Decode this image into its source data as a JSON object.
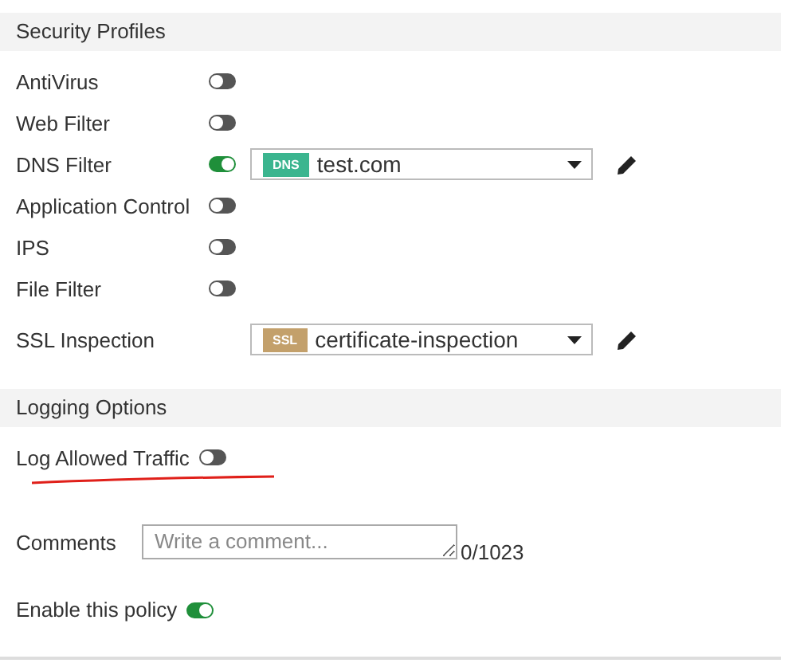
{
  "sections": [
    {
      "title": "Security Profiles",
      "rows": [
        {
          "label": "AntiVirus",
          "on": false
        },
        {
          "label": "Web Filter",
          "on": false
        },
        {
          "label": "DNS Filter",
          "on": true,
          "profile": {
            "tag": "DNS",
            "color": "#3bb58f",
            "value": "test.com"
          }
        },
        {
          "label": "Application Control",
          "on": false
        },
        {
          "label": "IPS",
          "on": false
        },
        {
          "label": "File Filter",
          "on": false
        },
        {
          "label": "SSL Inspection",
          "profile": {
            "tag": "SSL",
            "color": "#c3a06b",
            "value": "certificate-inspection"
          }
        }
      ]
    },
    {
      "title": "Logging Options",
      "rows": [
        {
          "label": "Log Allowed Traffic",
          "on": false,
          "underlined": true
        }
      ]
    }
  ],
  "comments": {
    "label": "Comments",
    "placeholder": "Write a comment...",
    "counter": "0/1023"
  },
  "enable": {
    "label": "Enable this policy",
    "on": true
  }
}
